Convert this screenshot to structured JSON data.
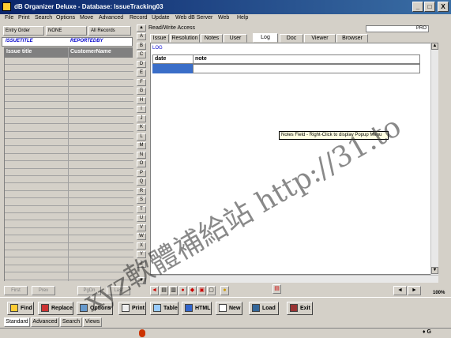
{
  "window": {
    "title": "dB Organizer Deluxe - Database: IssueTracking03",
    "minimize": "_",
    "maximize": "□",
    "close": "X"
  },
  "menu": [
    "File",
    "Print",
    "Search",
    "Options",
    "Move",
    "Advanced",
    "Record",
    "Update",
    "Web dB Server",
    "Web",
    "Help"
  ],
  "left_toolbar": {
    "entry_order": "Entry Order",
    "none": "NONE",
    "all_records": "All Records"
  },
  "left_header": {
    "issuetitle": "ISSUETITLE",
    "reportedby": "REPORTEDBY"
  },
  "grid": {
    "columns": [
      "Issue title",
      "CustomerName"
    ]
  },
  "nav": {
    "first": "First",
    "prev": "Prev",
    "pgdn": "PgDn",
    "last": "Last"
  },
  "alpha": [
    "A",
    "B",
    "C",
    "D",
    "E",
    "F",
    "G",
    "H",
    "I",
    "J",
    "K",
    "L",
    "M",
    "N",
    "O",
    "P",
    "Q",
    "R",
    "S",
    "T",
    "U",
    "V",
    "W",
    "X",
    "Y",
    "Z"
  ],
  "right": {
    "access": "Read/Write Access",
    "pro_label": "PRO",
    "tabs": [
      "Issue",
      "Resolution",
      "Notes",
      "User",
      "Log",
      "Doc",
      "Viewer",
      "Browser"
    ],
    "active_tab": "Log",
    "log_label": "LOG",
    "log_columns": [
      "date",
      "note"
    ],
    "tooltip": "Notes Field - Right-Click to display Popup Menu",
    "zoom": "100%"
  },
  "buttons": [
    "Find",
    "Replace",
    "Options",
    "Print",
    "Table",
    "HTML",
    "New",
    "Load",
    "Exit"
  ],
  "bottom_tabs": [
    "Standard",
    "Advanced",
    "Search",
    "Views"
  ],
  "watermark": "xyz軟體補給站 http://31.to",
  "colors": {
    "titlebar": "#0a246a",
    "selection": "#3a6ec8",
    "face": "#d4d0c8"
  }
}
